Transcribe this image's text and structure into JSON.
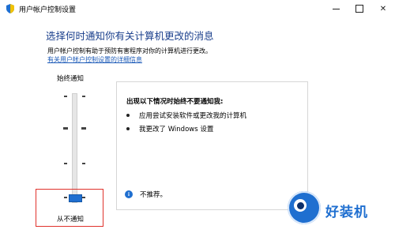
{
  "window": {
    "title": "用户帐户控制设置",
    "icon": "uac-shield-icon"
  },
  "content": {
    "heading": "选择何时通知你有关计算机更改的消息",
    "description": "用户帐户控制有助于预防有害程序对你的计算机进行更改。",
    "detail_link": "有关用户帐户控制设置的详细信息"
  },
  "slider": {
    "top_label": "始终通知",
    "bottom_label": "从不通知",
    "levels": 4,
    "selected_level": 1,
    "thumb_color": "#1f6fd0"
  },
  "panel": {
    "title": "出现以下情况时始终不要通知我:",
    "bullets": [
      "应用尝试安装软件或更改我的计算机",
      "我更改了 Windows 设置"
    ],
    "note": "不推荐。"
  },
  "highlight_color": "#e0322c",
  "watermark": {
    "text": "好装机"
  },
  "colors": {
    "heading": "#1a3f8c",
    "link": "#1d5bb8",
    "accent": "#1f6fd0"
  }
}
